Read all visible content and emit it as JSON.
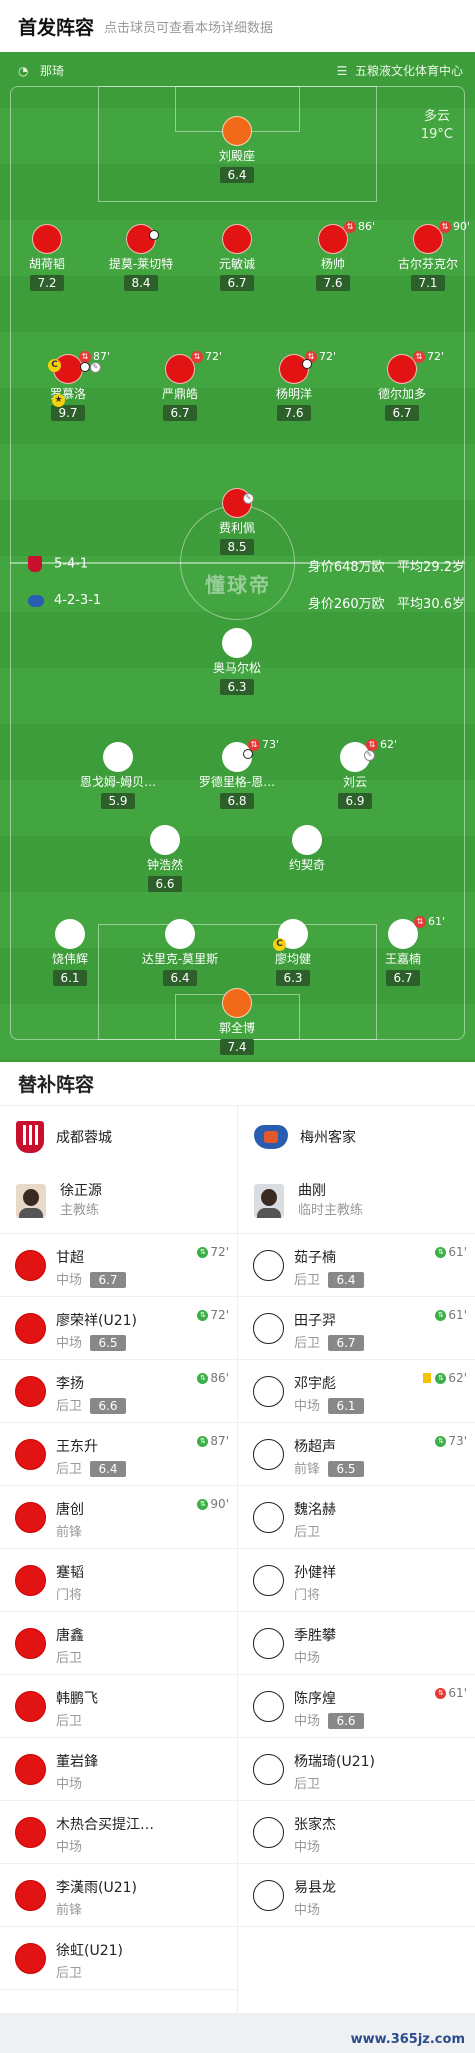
{
  "header": {
    "title": "首发阵容",
    "subtitle": "点击球员可查看本场详细数据"
  },
  "venue": {
    "referee": "那琦",
    "stadium": "五粮液文化体育中心",
    "weather": "多云",
    "temp": "19°C"
  },
  "home": {
    "formation": "5-4-1",
    "value": "身价648万欧",
    "age": "平均29.2岁",
    "color": "#e21313",
    "team": "成都蓉城",
    "coach_name": "徐正源",
    "coach_role": "主教练"
  },
  "away": {
    "formation": "4-2-3-1",
    "value": "身价260万欧",
    "age": "平均30.6岁",
    "color": "#ffffff",
    "team": "梅州客家",
    "coach_name": "曲刚",
    "coach_role": "临时主教练"
  },
  "watermark": "懂球帝",
  "home_players": [
    {
      "name": "刘殿座",
      "rating": "6.4",
      "gk": true
    },
    {
      "name": "胡荷韬",
      "rating": "7.2"
    },
    {
      "name": "提莫-莱切特",
      "rating": "8.4"
    },
    {
      "name": "元敏诚",
      "rating": "6.7"
    },
    {
      "name": "杨帅",
      "rating": "7.6",
      "sub": "86'"
    },
    {
      "name": "古尔芬克尔",
      "rating": "7.1",
      "sub": "90'"
    },
    {
      "name": "罗慕洛",
      "rating": "9.7",
      "sub": "87'"
    },
    {
      "name": "严鼎皓",
      "rating": "6.7",
      "sub": "72'"
    },
    {
      "name": "杨明洋",
      "rating": "7.6",
      "sub": "72'"
    },
    {
      "name": "德尔加多",
      "rating": "6.7",
      "sub": "72'"
    },
    {
      "name": "费利佩",
      "rating": "8.5"
    }
  ],
  "away_players": [
    {
      "name": "奥马尔松",
      "rating": "6.3"
    },
    {
      "name": "恩戈姆-姆贝…",
      "rating": "5.9"
    },
    {
      "name": "罗德里格-恩…",
      "rating": "6.8",
      "sub": "73'"
    },
    {
      "name": "刘云",
      "rating": "6.9",
      "sub": "62'"
    },
    {
      "name": "钟浩然",
      "rating": "6.6"
    },
    {
      "name": "约契奇",
      "rating": ""
    },
    {
      "name": "饶伟辉",
      "rating": "6.1"
    },
    {
      "name": "达里克-莫里斯",
      "rating": "6.4"
    },
    {
      "name": "廖均健",
      "rating": "6.3"
    },
    {
      "name": "王嘉楠",
      "rating": "6.7",
      "sub": "61'"
    },
    {
      "name": "郭全博",
      "rating": "7.4",
      "gk": true
    }
  ],
  "subs_title": "替补阵容",
  "home_subs": [
    {
      "name": "甘超",
      "pos": "中场",
      "rating": "6.7",
      "in": "72'"
    },
    {
      "name": "廖荣祥(U21)",
      "pos": "中场",
      "rating": "6.5",
      "in": "72'"
    },
    {
      "name": "李扬",
      "pos": "后卫",
      "rating": "6.6",
      "in": "86'"
    },
    {
      "name": "王东升",
      "pos": "后卫",
      "rating": "6.4",
      "in": "87'"
    },
    {
      "name": "唐创",
      "pos": "前锋",
      "rating": "",
      "in": "90'"
    },
    {
      "name": "蹇韬",
      "pos": "门将",
      "rating": "",
      "in": ""
    },
    {
      "name": "唐鑫",
      "pos": "后卫",
      "rating": "",
      "in": ""
    },
    {
      "name": "韩鹏飞",
      "pos": "后卫",
      "rating": "",
      "in": ""
    },
    {
      "name": "董岩鋒",
      "pos": "中场",
      "rating": "",
      "in": ""
    },
    {
      "name": "木热合买提江…",
      "pos": "中场",
      "rating": "",
      "in": ""
    },
    {
      "name": "李漢雨(U21)",
      "pos": "前锋",
      "rating": "",
      "in": ""
    },
    {
      "name": "徐虹(U21)",
      "pos": "后卫",
      "rating": "",
      "in": ""
    }
  ],
  "away_subs": [
    {
      "name": "茹子楠",
      "pos": "后卫",
      "rating": "6.4",
      "in": "61'"
    },
    {
      "name": "田子羿",
      "pos": "后卫",
      "rating": "6.7",
      "in": "61'"
    },
    {
      "name": "邓宇彪",
      "pos": "中场",
      "rating": "6.1",
      "in": "62'",
      "yellow": true
    },
    {
      "name": "杨超声",
      "pos": "前锋",
      "rating": "6.5",
      "in": "73'"
    },
    {
      "name": "魏洺赫",
      "pos": "后卫",
      "rating": "",
      "in": ""
    },
    {
      "name": "孙健祥",
      "pos": "门将",
      "rating": "",
      "in": ""
    },
    {
      "name": "季胜攀",
      "pos": "中场",
      "rating": "",
      "in": ""
    },
    {
      "name": "陈序煌",
      "pos": "中场",
      "rating": "6.6",
      "in": "61'",
      "out": true
    },
    {
      "name": "杨瑞琦(U21)",
      "pos": "后卫",
      "rating": "",
      "in": ""
    },
    {
      "name": "张家杰",
      "pos": "中场",
      "rating": "",
      "in": ""
    },
    {
      "name": "易县龙",
      "pos": "中场",
      "rating": "",
      "in": ""
    }
  ],
  "footer": "www.365jz.com"
}
